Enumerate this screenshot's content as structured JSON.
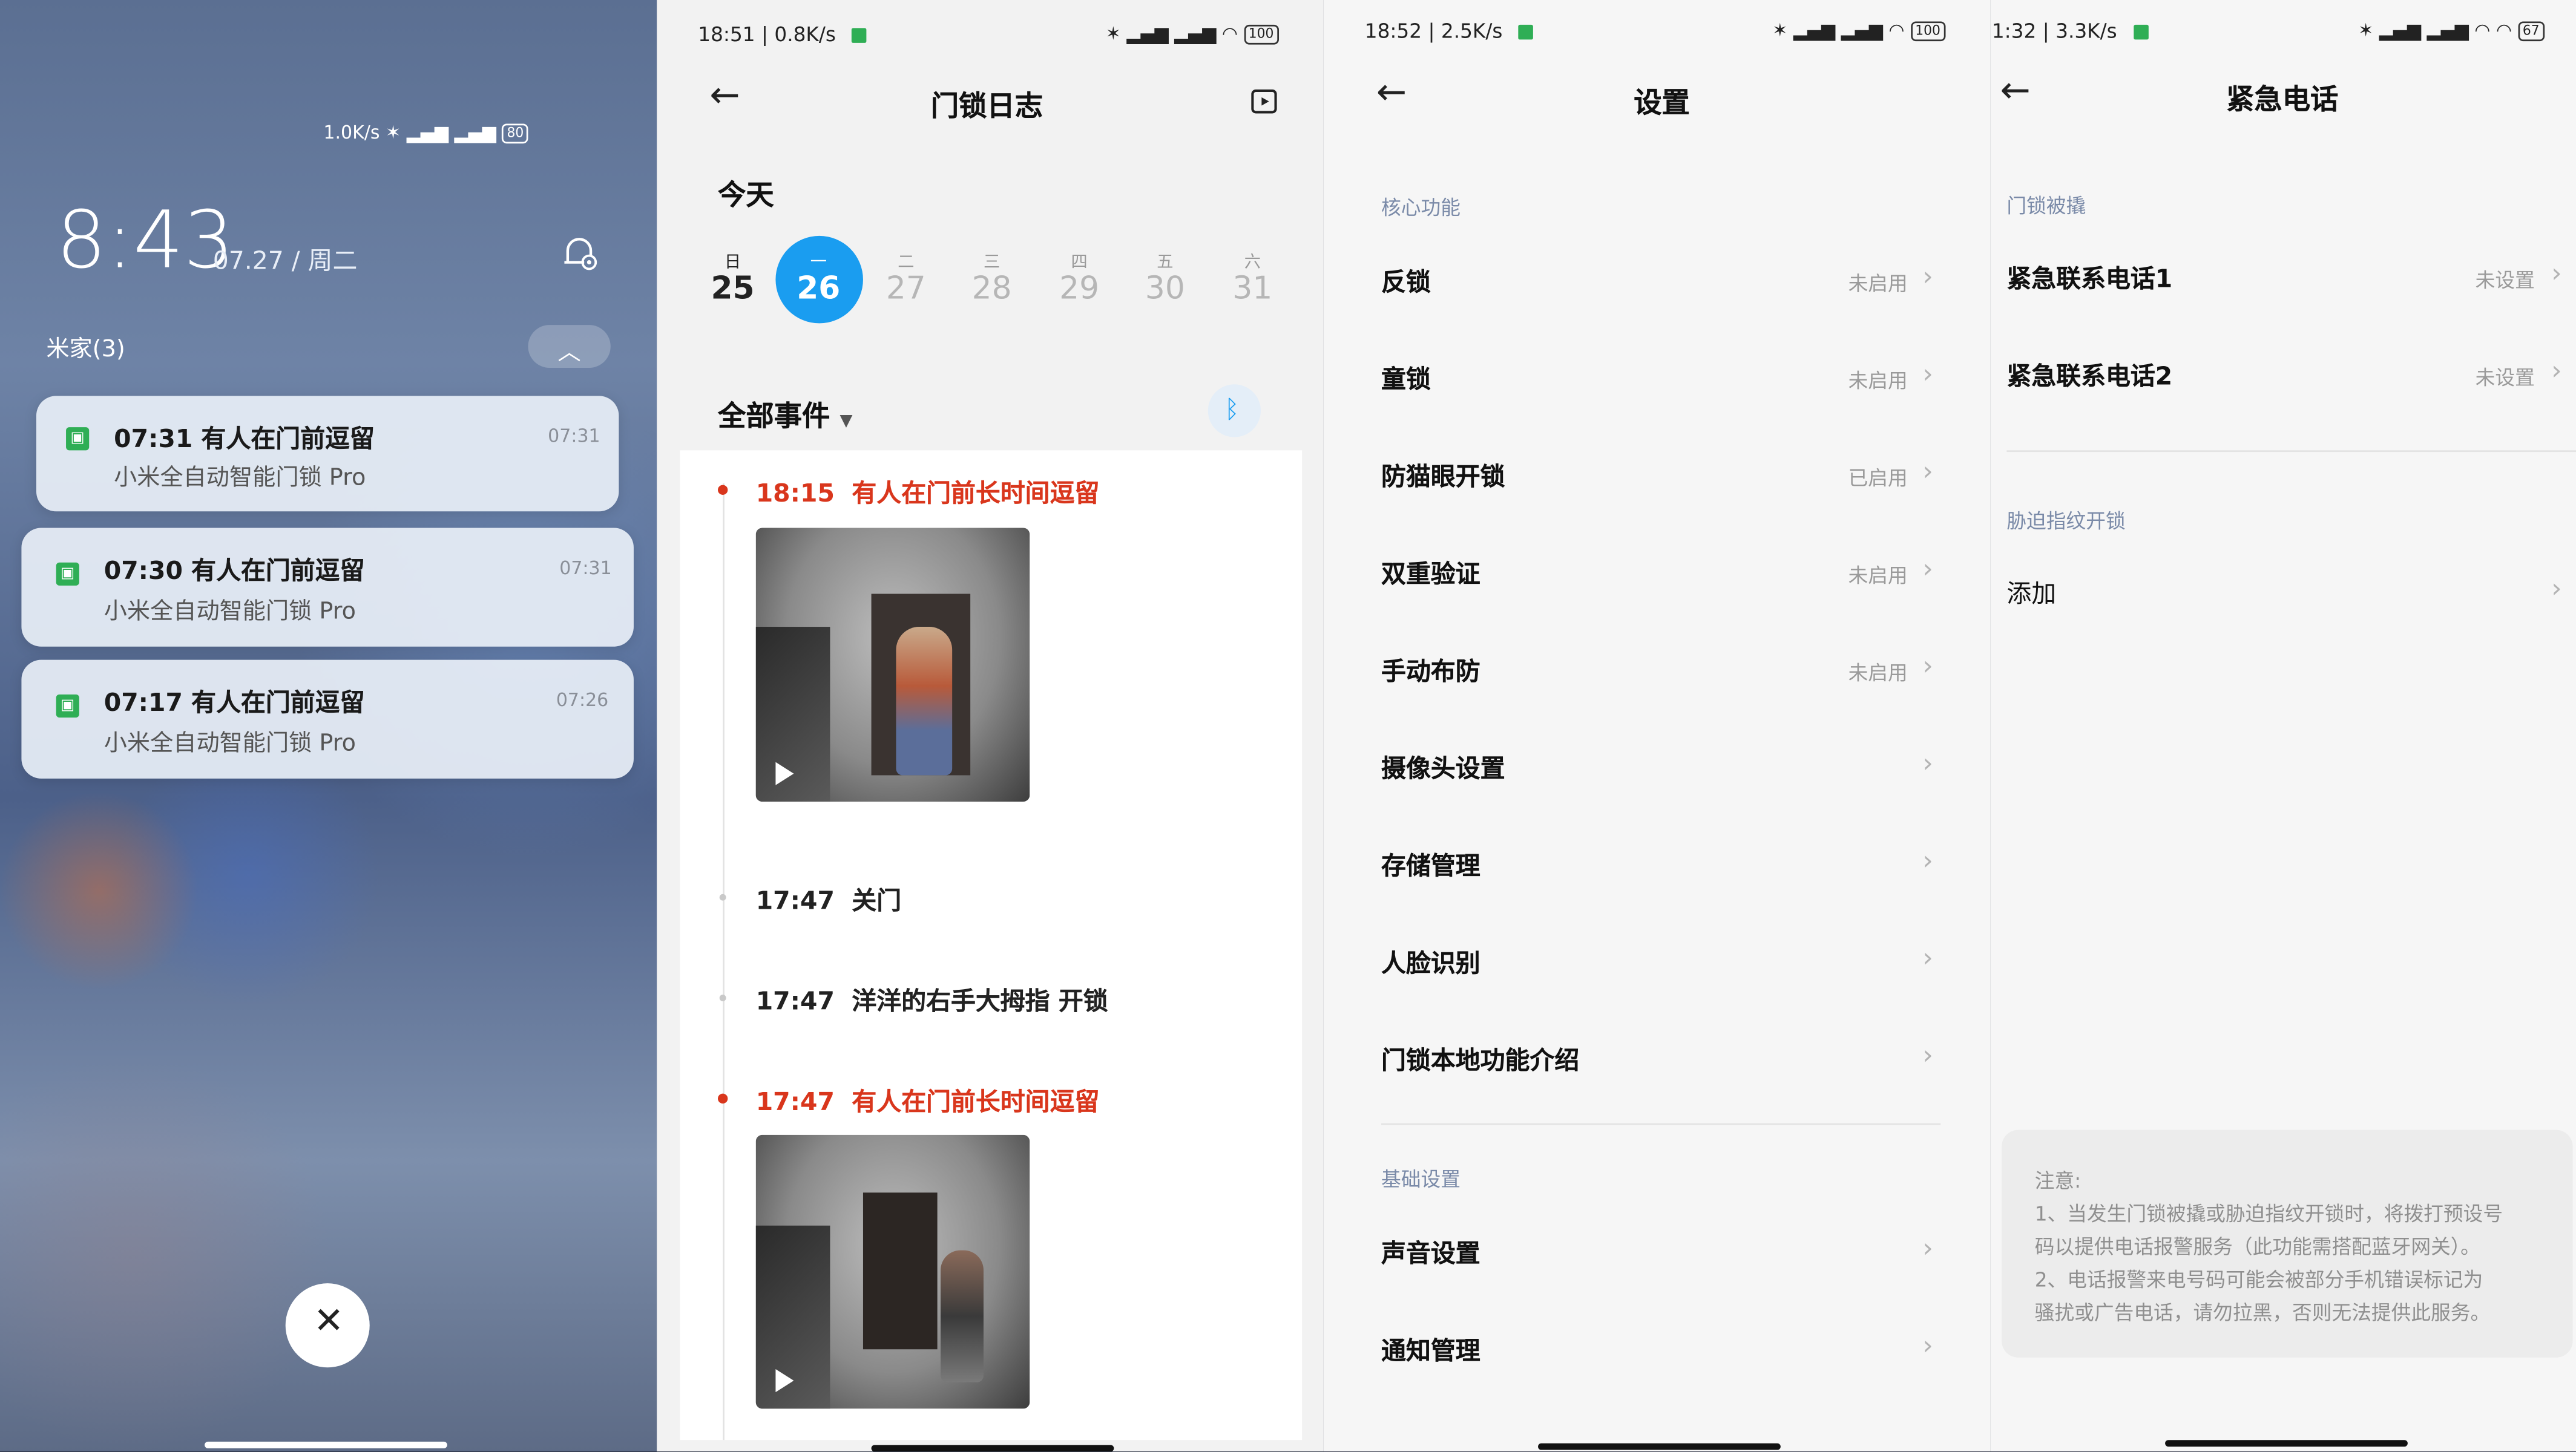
{
  "lockscreen": {
    "status": "1.0K/s",
    "battery": "80",
    "time": "8:43",
    "date": "07.27 / 周二",
    "group": "米家(3)",
    "notifications": [
      {
        "title": "07:31 有人在门前逗留",
        "subtitle": "小米全自动智能门锁 Pro",
        "time": "07:31"
      },
      {
        "title": "07:30 有人在门前逗留",
        "subtitle": "小米全自动智能门锁 Pro",
        "time": "07:31"
      },
      {
        "title": "07:17 有人在门前逗留",
        "subtitle": "小米全自动智能门锁 Pro",
        "time": "07:26"
      }
    ],
    "close_icon": "close-icon",
    "settings_icon": "notification-settings-icon"
  },
  "log": {
    "status": "18:51 | 0.8K/s",
    "battery": "100",
    "title": "门锁日志",
    "today": "今天",
    "days": [
      {
        "label": "日",
        "num": "25"
      },
      {
        "label": "一",
        "num": "26"
      },
      {
        "label": "二",
        "num": "27"
      },
      {
        "label": "三",
        "num": "28"
      },
      {
        "label": "四",
        "num": "29"
      },
      {
        "label": "五",
        "num": "30"
      },
      {
        "label": "六",
        "num": "31"
      }
    ],
    "filter": "全部事件",
    "events": [
      {
        "time": "18:15",
        "text": "有人在门前长时间逗留"
      },
      {
        "time": "17:47",
        "text": "关门"
      },
      {
        "time": "17:47",
        "text": "洋洋的右手大拇指 开锁"
      },
      {
        "time": "17:47",
        "text": "有人在门前长时间逗留"
      }
    ],
    "accent": "#1a9df0",
    "alert_color": "#d9361c"
  },
  "settings": {
    "status": "18:52 | 2.5K/s",
    "battery": "100",
    "title": "设置",
    "section_core": "核心功能",
    "rows": [
      {
        "label": "反锁",
        "value": "未启用"
      },
      {
        "label": "童锁",
        "value": "未启用"
      },
      {
        "label": "防猫眼开锁",
        "value": "已启用"
      },
      {
        "label": "双重验证",
        "value": "未启用"
      },
      {
        "label": "手动布防",
        "value": "未启用"
      },
      {
        "label": "摄像头设置",
        "value": ""
      },
      {
        "label": "存储管理",
        "value": ""
      },
      {
        "label": "人脸识别",
        "value": ""
      },
      {
        "label": "门锁本地功能介绍",
        "value": ""
      }
    ],
    "section_basic": "基础设置",
    "basic_rows": [
      {
        "label": "声音设置"
      },
      {
        "label": "通知管理"
      }
    ]
  },
  "emergency": {
    "status": "1:32 | 3.3K/s",
    "battery": "67",
    "title": "紧急电话",
    "section1": "门锁被撬",
    "rows": [
      {
        "label": "紧急联系电话1",
        "value": "未设置"
      },
      {
        "label": "紧急联系电话2",
        "value": "未设置"
      }
    ],
    "section2": "胁迫指纹开锁",
    "add": "添加",
    "note": [
      "注意:",
      "1、当发生门锁被撬或胁迫指纹开锁时，将拨打预设号",
      "码以提供电话报警服务（此功能需搭配蓝牙网关）。",
      "2、电话报警来电号码可能会被部分手机错误标记为",
      "骚扰或广告电话，请勿拉黑，否则无法提供此服务。"
    ]
  }
}
